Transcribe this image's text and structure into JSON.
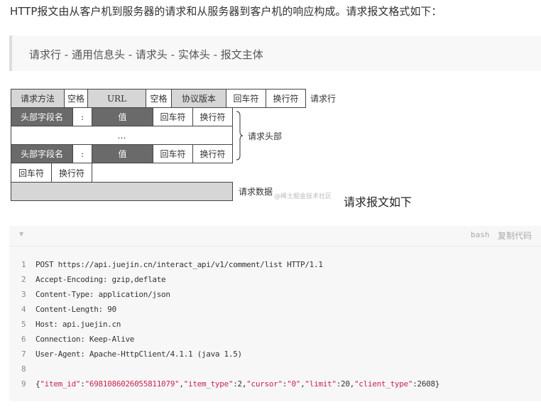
{
  "intro": "HTTP报文由从客户机到服务器的请求和从服务器到客户机的响应构成。请求报文格式如下：",
  "quote": "请求行 - 通用信息头 - 请求头 - 实体头 - 报文主体",
  "diagram": {
    "row1": [
      "请求方法",
      "空格",
      "URL",
      "空格",
      "协议版本",
      "回车符",
      "换行符"
    ],
    "row1_label": "请求行",
    "header_row": [
      "头部字段名",
      ":",
      "值",
      "回车符",
      "换行符"
    ],
    "ellipsis": "…",
    "end_row": [
      "回车符",
      "换行符"
    ],
    "headers_label": "请求头部",
    "data_label": "请求数据",
    "watermark": "@稀土掘金技术社区"
  },
  "caption": "请求报文如下",
  "code": {
    "lang": "bash",
    "copy": "复制代码",
    "lines": [
      "POST https://api.juejin.cn/interact_api/v1/comment/list HTTP/1.1",
      "Accept-Encoding: gzip,deflate",
      "Content-Type: application/json",
      "Content-Length: 90",
      "Host: api.juejin.cn",
      "Connection: Keep-Alive",
      "User-Agent: Apache-HttpClient/4.1.1 (java 1.5)",
      "",
      "{\"item_id\":\"6981086026055811079\",\"item_type\":2,\"cursor\":\"0\",\"limit\":20,\"client_type\":2608}"
    ],
    "line_numbers": [
      "1",
      "2",
      "3",
      "4",
      "5",
      "6",
      "7",
      "8",
      "9"
    ],
    "string_color": "#c7254e"
  }
}
